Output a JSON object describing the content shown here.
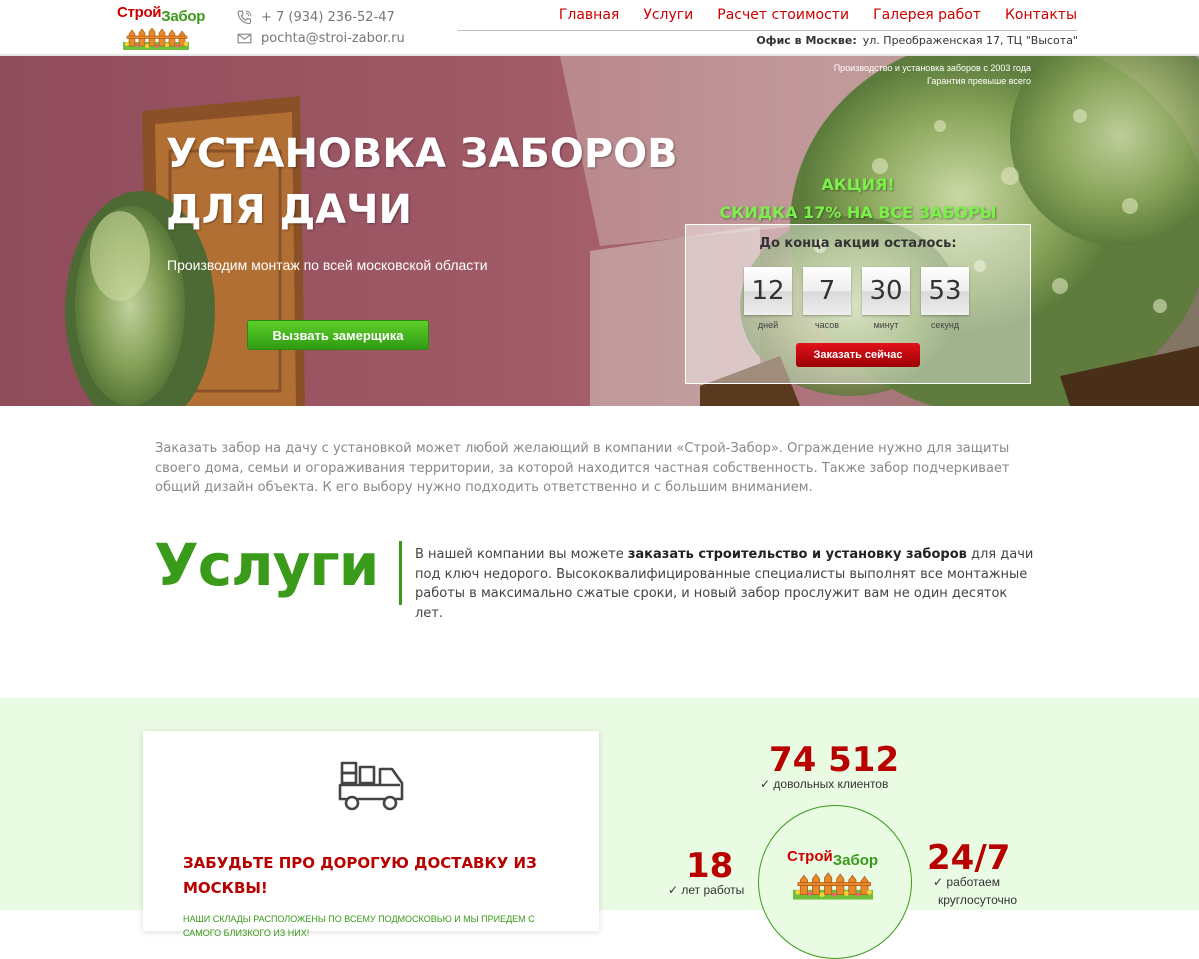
{
  "header": {
    "logo_text_red": "Строй",
    "logo_text_green": "Забор",
    "phone": "+ 7 (934) 236-52-47",
    "email": "pochta@stroi-zabor.ru",
    "nav": [
      "Главная",
      "Услуги",
      "Расчет стоимости",
      "Галерея работ",
      "Контакты"
    ],
    "office_label": "Офис в Москве:",
    "office_address": "ул. Преображенская 17, ТЦ \"Высота\""
  },
  "hero": {
    "tagline_1": "Производство и установка заборов с 2003 года",
    "tagline_2": "Гарантия превыше всего",
    "title_line1": "УСТАНОВКА ЗАБОРОВ",
    "title_line2": "ДЛЯ ДАЧИ",
    "subtitle": "Производим монтаж по всей московской области",
    "measure_button": "Вызвать замерщика",
    "promo_line1": "АКЦИЯ!",
    "promo_line2": "СКИДКА 17% НА ВСЕ ЗАБОРЫ",
    "timer_label": "До конца акции осталось:",
    "timer": [
      {
        "value": "12",
        "unit": "дней"
      },
      {
        "value": "7",
        "unit": "часов"
      },
      {
        "value": "30",
        "unit": "минут"
      },
      {
        "value": "53",
        "unit": "секунд"
      }
    ],
    "order_button": "Заказать сейчас"
  },
  "intro": {
    "text": "Заказать забор на дачу с установкой может любой желающий в компании «Строй-Забор». Ограждение нужно для защиты своего дома, семьи и огораживания территории, за которой находится частная собственность. Также забор подчеркивает общий дизайн объекта. К его выбору нужно подходить ответственно и с большим вниманием."
  },
  "services": {
    "title": "Услуги",
    "text_before": "В нашей компании вы можете ",
    "text_bold": "заказать строительство и установку заборов",
    "text_after": " для дачи под ключ недорого. Высококвалифицированные специалисты выполнят все монтажные работы в максимально сжатые сроки, и новый забор прослужит вам не один десяток лет."
  },
  "delivery": {
    "title": "ЗАБУДЬТЕ ПРО ДОРОГУЮ ДОСТАВКУ ИЗ МОСКВЫ!",
    "text": "НАШИ СКЛАДЫ РАСПОЛОЖЕНЫ ПО ВСЕМУ ПОДМОСКОВЬЮ И МЫ ПРИЕДЕМ С САМОГО БЛИЗКОГО ИЗ НИХ!"
  },
  "stats": {
    "clients_value": "74 512",
    "clients_label": "✓ довольных клиентов",
    "years_value": "18",
    "years_label": "✓ лет работы",
    "hours_value": "24/7",
    "hours_label_1": "✓ работаем",
    "hours_label_2": "круглосуточно"
  },
  "colors": {
    "accent_red": "#c00000",
    "accent_green": "#3a9a1a",
    "section_bg": "#eafbe4"
  }
}
